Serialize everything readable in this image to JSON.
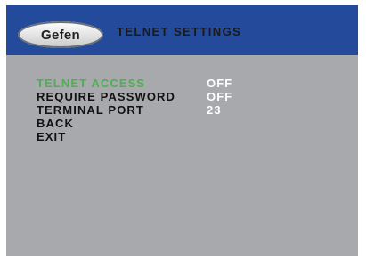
{
  "header": {
    "logo_text": "Gefen",
    "title": "TELNET SETTINGS"
  },
  "menu": {
    "items": [
      {
        "label": "TELNET ACCESS",
        "value": "OFF",
        "selected": true
      },
      {
        "label": "REQUIRE PASSWORD",
        "value": "OFF",
        "selected": false
      },
      {
        "label": "TERMINAL PORT",
        "value": "23",
        "selected": false
      },
      {
        "label": "BACK",
        "value": "",
        "selected": false
      },
      {
        "label": "EXIT",
        "value": "",
        "selected": false
      }
    ]
  },
  "colors": {
    "header_bg": "#234a9b",
    "panel_bg": "#a7a9ac",
    "selected_text": "#4caf50",
    "value_text": "#ffffff",
    "label_text": "#111111"
  }
}
